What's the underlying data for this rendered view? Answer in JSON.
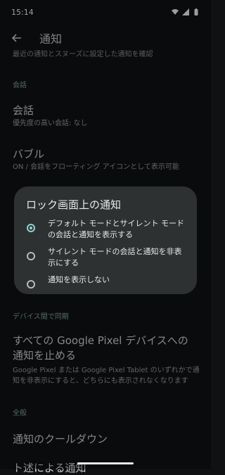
{
  "status_bar": {
    "time": "15:14"
  },
  "app_bar": {
    "back_icon": "arrow-back-icon",
    "title": "通知"
  },
  "list": {
    "cut_summary": "最近の通知とスヌーズに設定した通知を確認",
    "section_conversation": "会話",
    "conversation_title": "会話",
    "conversation_sub": "優先度の高い会話: なし",
    "bubble_title": "バブル",
    "bubble_sub": "ON / 会話をフローティング アイコンとして表示可能",
    "section_devices": "デバイス間で同期",
    "sync_title": "すべての Google Pixel デバイスへの通知を止める",
    "sync_sub": "Google Pixel または Google Pixel Tablet のいずれかで通知を非表示にすると、どちらにも表示されなくなります",
    "section_general": "全般",
    "cooldown_title": "通知のクールダウン",
    "cut_bottom": "ト述による通知"
  },
  "dialog": {
    "title": "ロック画面上の通知",
    "options": [
      {
        "label": "デフォルト モードとサイレント モードの会話と通知を表示する",
        "selected": true
      },
      {
        "label": "サイレント モードの会話と通知を非表示にする",
        "selected": false
      },
      {
        "label": "通知を表示しない",
        "selected": false
      }
    ]
  },
  "colors": {
    "accent": "#8fd3cf",
    "dialog_bg": "#2e3132",
    "background": "#101113"
  }
}
